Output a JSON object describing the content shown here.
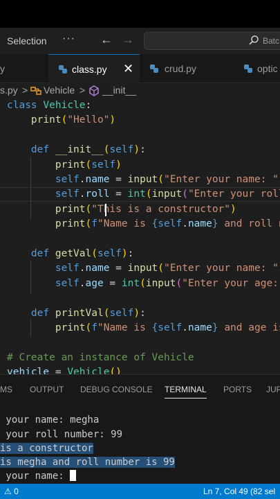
{
  "titlebar": {
    "menu_selection": "Selection",
    "menu_more": "···",
    "back": "←",
    "forward": "→",
    "search_text": "Batc"
  },
  "tabs": [
    {
      "label": "y"
    },
    {
      "label": "class.py",
      "close": "✕"
    },
    {
      "label": "crud.py"
    },
    {
      "label": "optic"
    }
  ],
  "breadcrumb": {
    "file": "s.py",
    "sep1": ">",
    "class": "Vehicle",
    "sep2": ">",
    "method": "__init__"
  },
  "panel": {
    "tabs": [
      "MS",
      "OUTPUT",
      "DEBUG CONSOLE",
      "TERMINAL",
      "PORTS",
      "JUP"
    ],
    "active_tab": "TERMINAL"
  },
  "terminal": {
    "lines": [
      " your name: megha",
      " your roll number: 99",
      "is a constructor",
      "is megha and roll number is 99",
      " your name: "
    ]
  },
  "status": {
    "left": "⚠ 0",
    "right": "Ln 7, Col 49 (82 sel"
  },
  "colors": {
    "accent": "#007acc",
    "selection": "#264f78",
    "editor_bg": "#1e1e1e"
  }
}
